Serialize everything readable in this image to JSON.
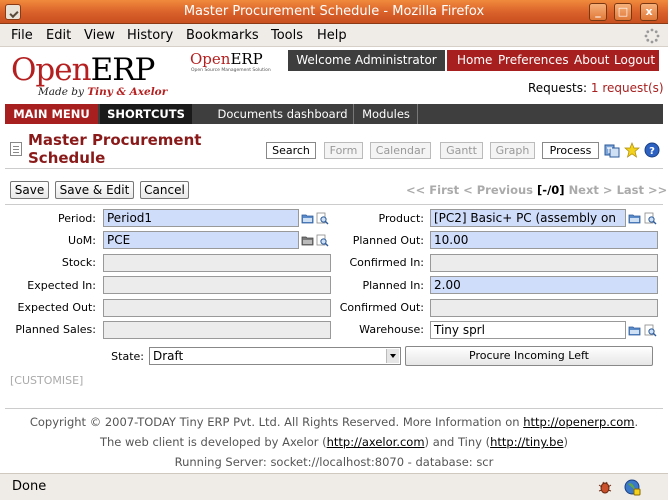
{
  "window": {
    "title": "Master Procurement Schedule - Mozilla Firefox",
    "controls": [
      "_",
      "□",
      "x"
    ]
  },
  "menubar": {
    "items": [
      "File",
      "Edit",
      "View",
      "History",
      "Bookmarks",
      "Tools",
      "Help"
    ]
  },
  "header": {
    "logo_open": "Open",
    "logo_erp": "ERP",
    "made_by_prefix": "Made by",
    "made_by_names": "Tiny & Axelor",
    "small_logo_open": "Open",
    "small_logo_erp": "ERP",
    "small_logo_sub": "Open Source Management Solution",
    "welcome": "Welcome Administrator",
    "nav": [
      "Home",
      "Preferences",
      "About",
      "Logout"
    ],
    "requests_label": "Requests:",
    "requests_link": "1 request(s)"
  },
  "navbar": {
    "main_menu": "MAIN MENU",
    "shortcuts": "SHORTCUTS",
    "documents_dashboard": "Documents dashboard",
    "modules": "Modules"
  },
  "page": {
    "title": "Master Procurement Schedule",
    "views": [
      "Search",
      "Form",
      "Calendar",
      "Gantt",
      "Graph",
      "Process"
    ]
  },
  "actions": {
    "save": "Save",
    "save_edit": "Save & Edit",
    "cancel": "Cancel"
  },
  "pager": {
    "first": "<< First",
    "previous": "< Previous",
    "counter": "[-/0]",
    "next": "Next >",
    "last": "Last >>"
  },
  "form": {
    "period_label": "Period:",
    "period_value": "Period1",
    "uom_label": "UoM:",
    "uom_value": "PCE",
    "stock_label": "Stock:",
    "expected_in_label": "Expected In:",
    "expected_out_label": "Expected Out:",
    "planned_sales_label": "Planned Sales:",
    "product_label": "Product:",
    "product_value": "[PC2] Basic+ PC (assembly on",
    "planned_out_label": "Planned Out:",
    "planned_out_value": "10.00",
    "confirmed_in_label": "Confirmed In:",
    "planned_in_label": "Planned In:",
    "planned_in_value": "2.00",
    "confirmed_out_label": "Confirmed Out:",
    "warehouse_label": "Warehouse:",
    "warehouse_value": "Tiny sprl",
    "state_label": "State:",
    "state_value": "Draft",
    "procure_button": "Procure Incoming Left",
    "customise": "[CUSTOMISE]"
  },
  "footer": {
    "copyright": "Copyright © 2007-TODAY Tiny ERP Pvt. Ltd. All Rights Reserved. More Information on",
    "openerp_link": "http://openerp.com",
    "developed_prefix": "The web client is developed by Axelor (",
    "axelor_link": "http://axelor.com",
    "developed_mid": ") and Tiny (",
    "tiny_link": "http://tiny.be",
    "developed_suffix": ")",
    "server": "Running Server: socket://localhost:8070 - database: scr"
  },
  "statusbar": {
    "status": "Done"
  },
  "colors": {
    "brand_red": "#a81f1f",
    "dark_bar": "#3e3e3e",
    "required_field": "#cfdcfa",
    "titlebar_orange": "#d9602a"
  }
}
